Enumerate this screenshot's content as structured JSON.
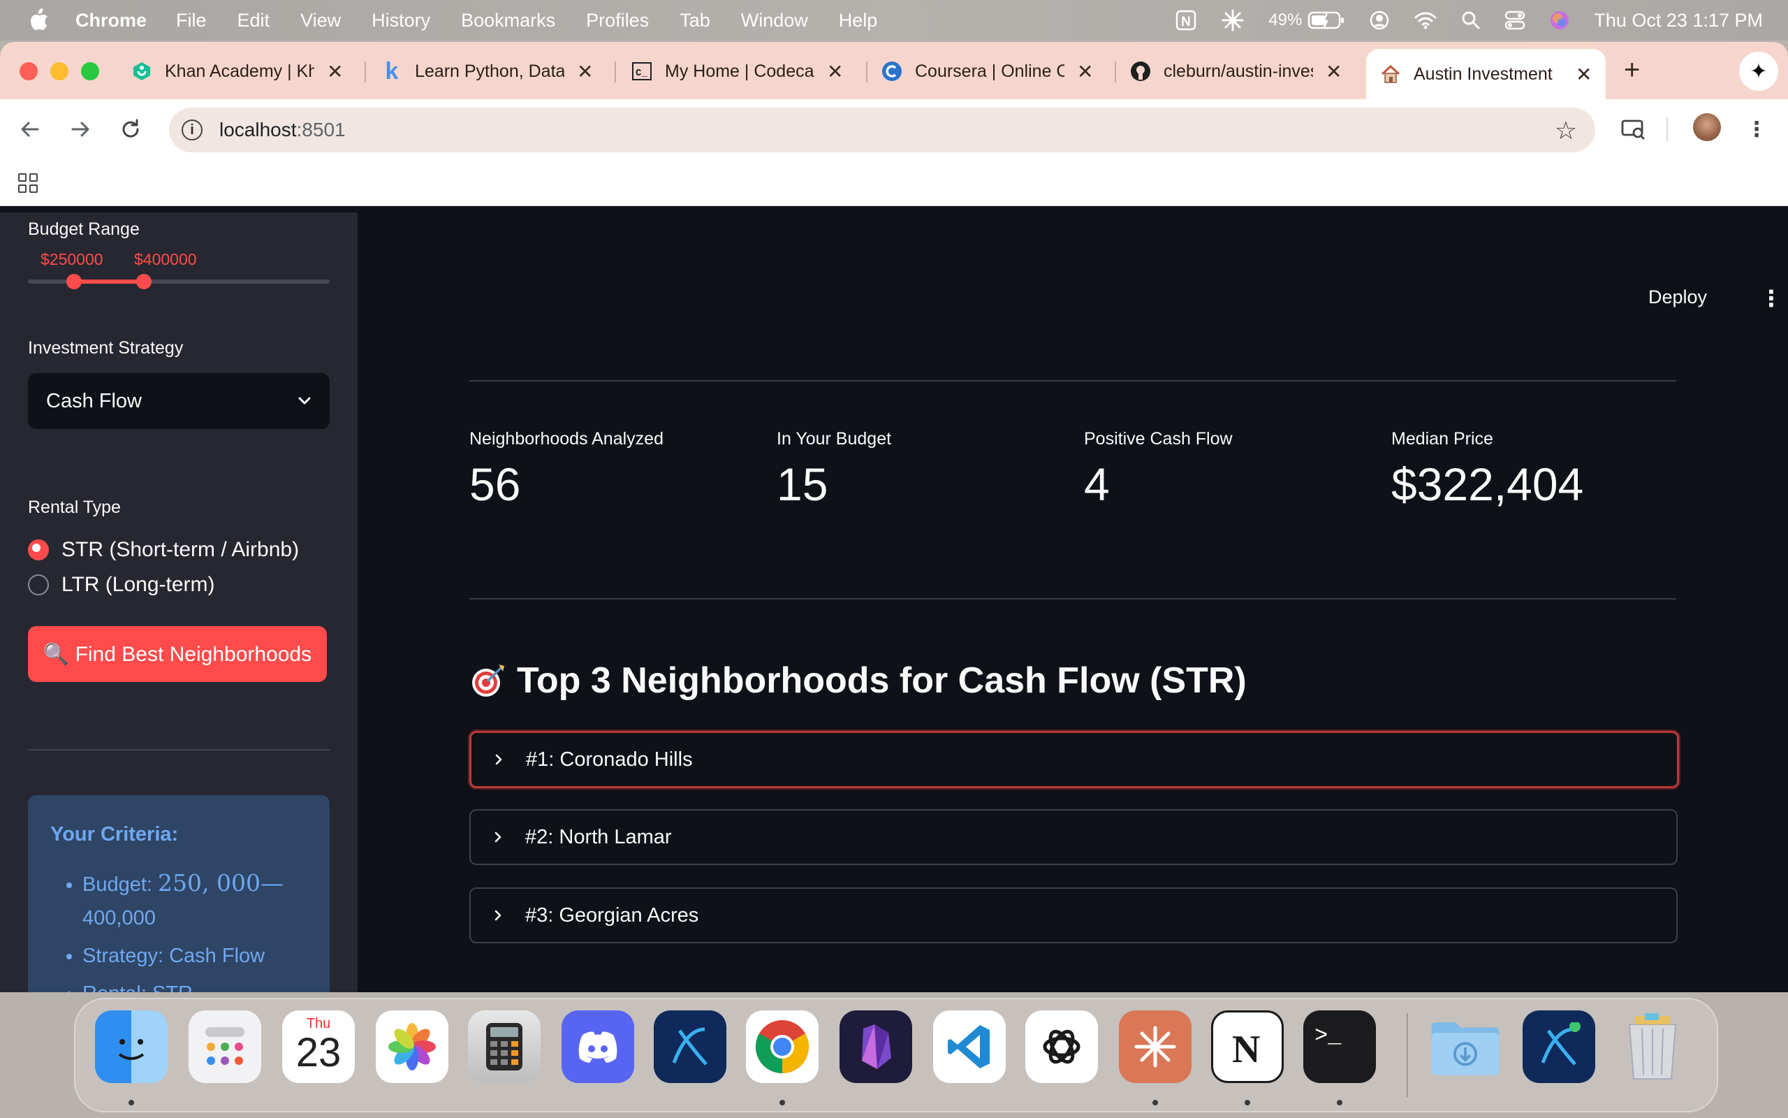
{
  "menubar": {
    "app_name": "Chrome",
    "menus": [
      "File",
      "Edit",
      "View",
      "History",
      "Bookmarks",
      "Profiles",
      "Tab",
      "Window",
      "Help"
    ],
    "battery": "49%",
    "clock": "Thu Oct 23  1:17 PM"
  },
  "tabs": [
    {
      "title": "Khan Academy | Khan",
      "icon": "khan-academy-icon",
      "color": "#14bf96"
    },
    {
      "title": "Learn Python, Data",
      "icon": "k-icon",
      "color": "#4a8fe7"
    },
    {
      "title": "My Home | Codecademy",
      "icon": "codecademy-icon",
      "color": "#1f1f1f"
    },
    {
      "title": "Coursera | Online Courses",
      "icon": "coursera-icon",
      "color": "#2a73cc"
    },
    {
      "title": "cleburn/austin-investment",
      "icon": "github-icon",
      "color": "#1f1f1f"
    },
    {
      "title": "Austin Investment",
      "icon": "house-icon",
      "color": "#c0573a"
    }
  ],
  "address_bar": {
    "host": "localhost",
    "port": ":8501"
  },
  "sidebar": {
    "budget_label": "Budget Range",
    "budget_min": "$250000",
    "budget_max": "$400000",
    "slider_fraction": {
      "low": 0.15,
      "high": 0.38
    },
    "strategy_label": "Investment Strategy",
    "strategy_value": "Cash Flow",
    "rental_label": "Rental Type",
    "rental_options": [
      "STR (Short-term / Airbnb)",
      "LTR (Long-term)"
    ],
    "rental_selected": 0,
    "find_button": "🔍 Find Best Neighborhoods",
    "criteria": {
      "heading": "Your Criteria:",
      "budget_prefix": "Budget: ",
      "budget_math": "250, 000—",
      "budget_rest": "400,000",
      "strategy": "Strategy: Cash Flow",
      "rental": "Rental: STR"
    }
  },
  "header": {
    "deploy": "Deploy"
  },
  "metrics": [
    {
      "label": "Neighborhoods Analyzed",
      "value": "56"
    },
    {
      "label": "In Your Budget",
      "value": "15"
    },
    {
      "label": "Positive Cash Flow",
      "value": "4"
    },
    {
      "label": "Median Price",
      "value": "$322,404"
    }
  ],
  "results": {
    "title": "Top 3 Neighborhoods for Cash Flow (STR)",
    "items": [
      "#1: Coronado Hills",
      "#2: North Lamar",
      "#3: Georgian Acres"
    ]
  },
  "dock": {
    "calendar_day": "Thu",
    "calendar_date": "23",
    "apps": [
      "finder",
      "launchpad",
      "calendar",
      "photos",
      "calculator",
      "discord",
      "app-x",
      "chrome",
      "app-obsidian",
      "vscode",
      "chatgpt",
      "claude",
      "notion",
      "terminal",
      "downloads",
      "app-x2",
      "trash"
    ]
  },
  "colors": {
    "accent": "#ff4b4b",
    "sidebar_bg": "#262730",
    "main_bg": "#0e1117",
    "criteria_bg": "#2e4565",
    "criteria_text": "#6fa8f0"
  }
}
